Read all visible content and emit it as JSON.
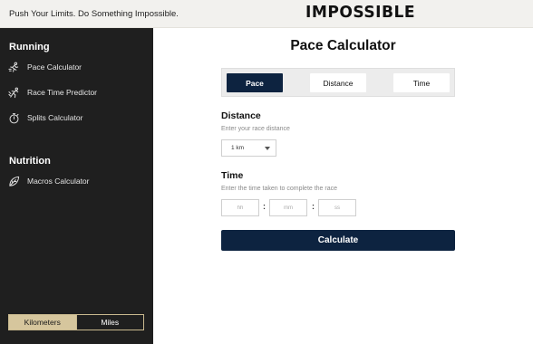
{
  "header": {
    "tagline": "Push Your Limits. Do Something Impossible.",
    "logo": "IMPOSSIBLE"
  },
  "sidebar": {
    "sections": [
      {
        "title": "Running",
        "items": [
          {
            "label": "Pace Calculator",
            "icon": "runner-icon"
          },
          {
            "label": "Race Time Predictor",
            "icon": "sprinter-icon"
          },
          {
            "label": "Splits Calculator",
            "icon": "stopwatch-icon"
          }
        ]
      },
      {
        "title": "Nutrition",
        "items": [
          {
            "label": "Macros Calculator",
            "icon": "leaf-icon"
          }
        ]
      }
    ],
    "units": {
      "options": [
        "Kilometers",
        "Miles"
      ],
      "selected": "Kilometers"
    }
  },
  "main": {
    "title": "Pace Calculator",
    "tabs": [
      {
        "label": "Pace",
        "active": true
      },
      {
        "label": "Distance",
        "active": false
      },
      {
        "label": "Time",
        "active": false
      }
    ],
    "distance": {
      "title": "Distance",
      "help": "Enter your race distance",
      "selected": "1 km"
    },
    "time": {
      "title": "Time",
      "help": "Enter the time taken to complete the race",
      "placeholders": {
        "hours": "hh",
        "minutes": "mm",
        "seconds": "ss"
      },
      "separator": ":"
    },
    "calculate_label": "Calculate"
  },
  "colors": {
    "navy": "#0d2340",
    "sidebar": "#1f1f1f",
    "gold": "#d6c69d"
  }
}
